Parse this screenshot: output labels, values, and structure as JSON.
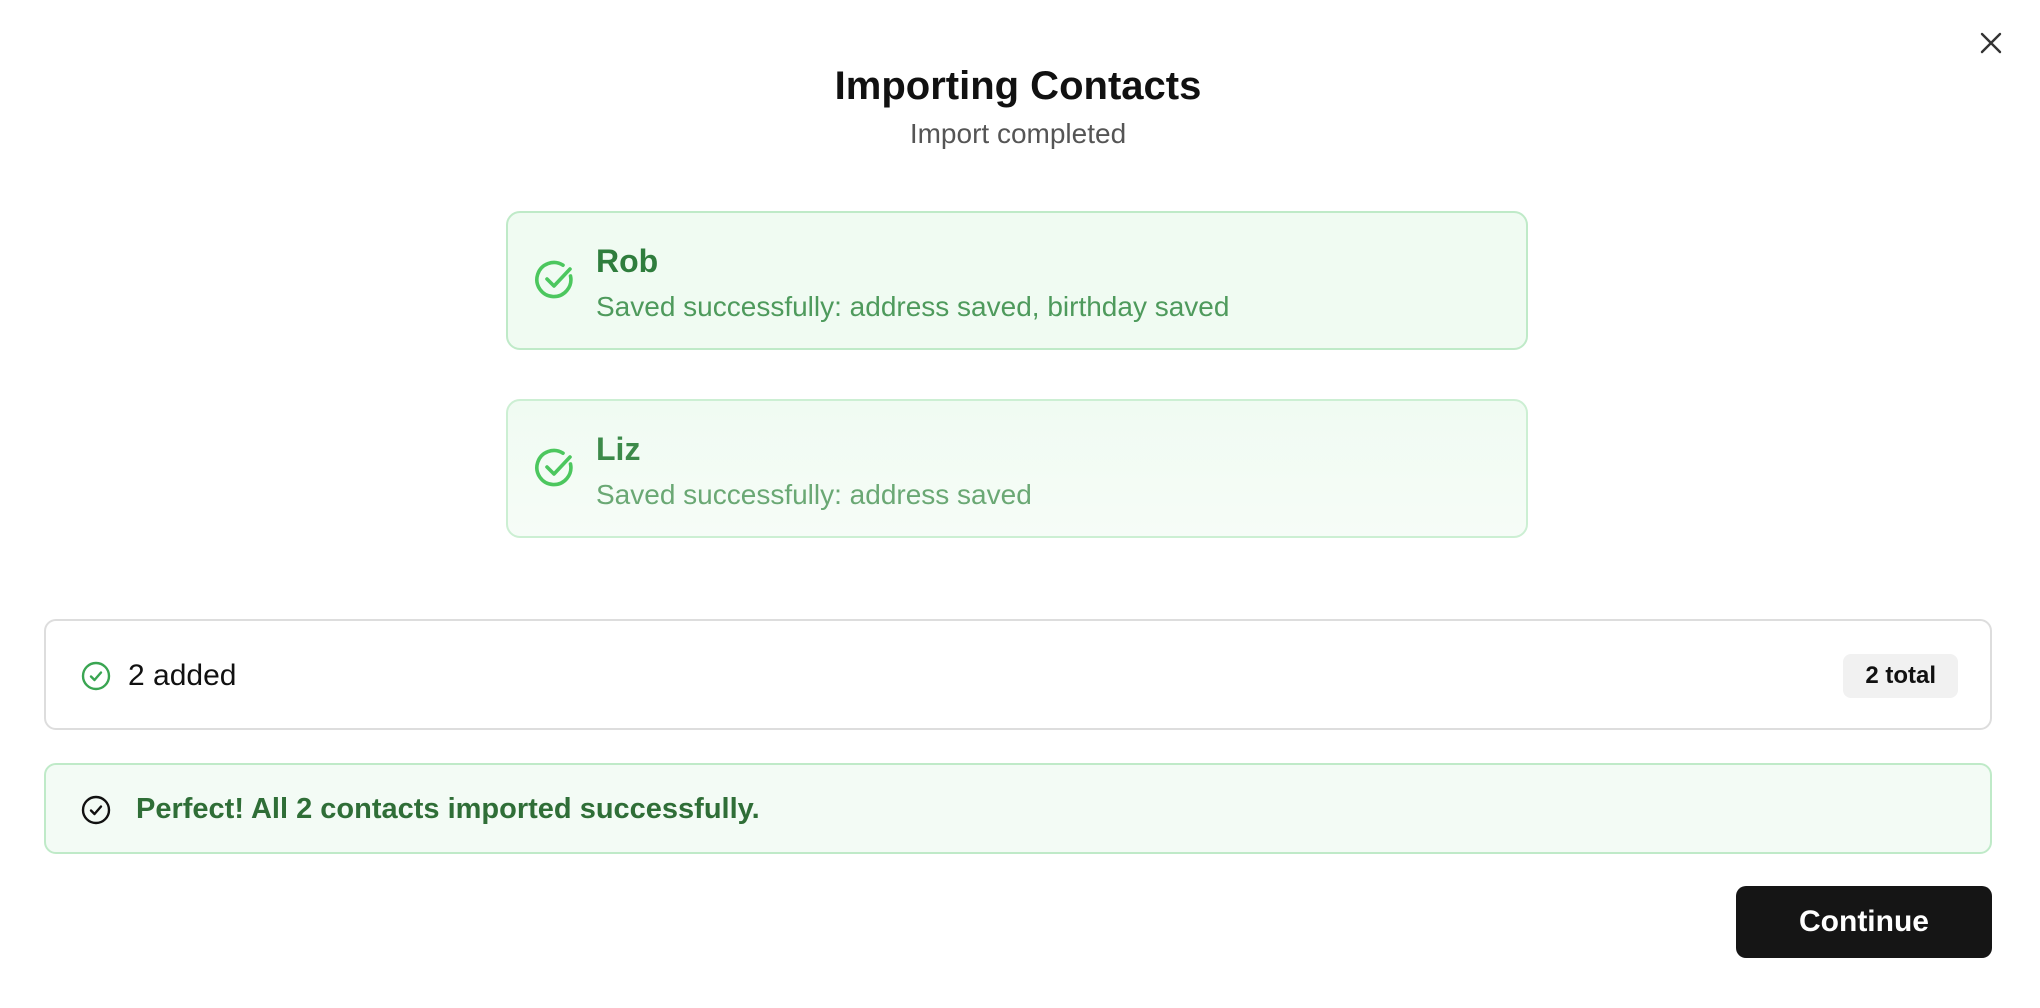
{
  "dialog": {
    "title": "Importing Contacts",
    "subtitle": "Import completed"
  },
  "results": [
    {
      "name": "Rob",
      "detail": "Saved successfully: address saved, birthday saved",
      "status": "success"
    },
    {
      "name": "Liz",
      "detail": "Saved successfully: address saved",
      "status": "success"
    }
  ],
  "summary": {
    "added_label": "2 added",
    "total_label": "2 total"
  },
  "banner": {
    "message": "Perfect! All 2 contacts imported successfully."
  },
  "actions": {
    "continue_label": "Continue"
  },
  "icons": {
    "close": "close-icon",
    "success": "check-circle-icon"
  },
  "colors": {
    "success_text": "#2f7d3d",
    "success_bg": "#f0fbf2",
    "success_border": "#bfeac8",
    "check_green": "#4cc75e",
    "primary_button": "#151515"
  }
}
